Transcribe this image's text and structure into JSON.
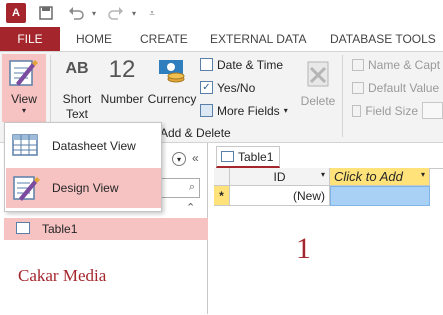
{
  "app": {
    "logo_text": "A"
  },
  "qat": {
    "save_icon": "save-icon",
    "undo_icon": "undo-icon",
    "redo_icon": "redo-icon",
    "customize_icon": "customize-icon"
  },
  "tabs": [
    {
      "label": "FILE",
      "active": false
    },
    {
      "label": "HOME",
      "active": false
    },
    {
      "label": "CREATE",
      "active": false
    },
    {
      "label": "EXTERNAL DATA",
      "active": false
    },
    {
      "label": "DATABASE TOOLS",
      "active": false
    }
  ],
  "ribbon": {
    "view_label": "View",
    "short_text_line1": "Short",
    "short_text_line2": "Text",
    "number_label": "Number",
    "currency_label": "Currency",
    "ab_glyph": "AB",
    "twelve_glyph": "12",
    "date_time": "Date & Time",
    "yes_no": "Yes/No",
    "more_fields": "More Fields",
    "delete_label": "Delete",
    "name_caption": "Name & Capt",
    "default_value": "Default Value",
    "field_size": "Field Size",
    "group_label": "Add & Delete"
  },
  "view_menu": {
    "items": [
      {
        "label": "Datasheet View",
        "highlighted": false
      },
      {
        "label": "Design View",
        "highlighted": true
      }
    ]
  },
  "nav": {
    "table_item": "Table1",
    "watermark": "Cakar Media"
  },
  "document": {
    "tab_label": "Table1",
    "columns": [
      "ID",
      "Click to Add"
    ],
    "new_row_marker": "*",
    "new_row_id": "(New)",
    "annotation": "1"
  },
  "colors": {
    "accent": "#a4262c",
    "highlight": "#f6c2c2",
    "selected_cell": "#a9d0f5",
    "header_selected": "#ffe37a"
  }
}
